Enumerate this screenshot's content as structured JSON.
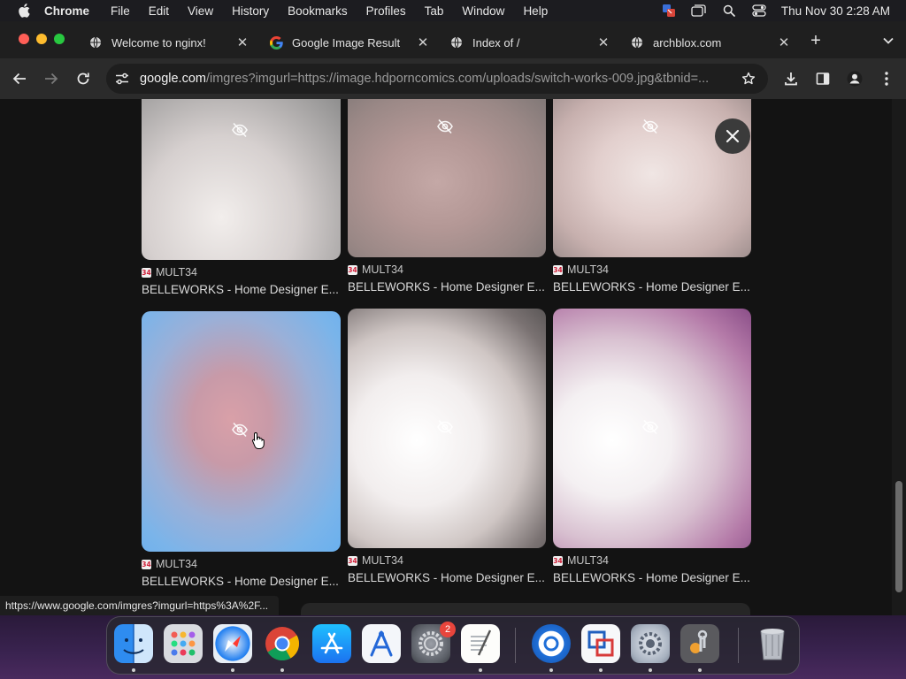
{
  "menubar": {
    "app_name": "Chrome",
    "menus": [
      "File",
      "Edit",
      "View",
      "History",
      "Bookmarks",
      "Profiles",
      "Tab",
      "Window",
      "Help"
    ],
    "clock": "Thu Nov 30  2:28 AM",
    "status_icons": [
      "screen-share-icon",
      "window-icon",
      "spotlight-search-icon",
      "control-center-icon"
    ]
  },
  "tabs": [
    {
      "label": "Welcome to nginx!",
      "favicon": "globe-icon"
    },
    {
      "label": "Google Image Result",
      "favicon": "google-icon"
    },
    {
      "label": "Index of /",
      "favicon": "globe-icon"
    },
    {
      "label": "archblox.com",
      "favicon": "globe-icon"
    }
  ],
  "newtab_label": "+",
  "toolbar": {
    "url_host": "google.com",
    "url_rest": "/imgres?imgurl=https://image.hdporncomics.com/uploads/switch-works-009.jpg&tbnid=..."
  },
  "results": [
    {
      "source": "MULT34",
      "badge": "34",
      "title": "BELLEWORKS - Home Designer E..."
    },
    {
      "source": "MULT34",
      "badge": "34",
      "title": "BELLEWORKS - Home Designer E..."
    },
    {
      "source": "MULT34",
      "badge": "34",
      "title": "BELLEWORKS - Home Designer E..."
    },
    {
      "source": "MULT34",
      "badge": "34",
      "title": "BELLEWORKS - Home Designer E..."
    },
    {
      "source": "MULT34",
      "badge": "34",
      "title": "BELLEWORKS - Home Designer E..."
    },
    {
      "source": "MULT34",
      "badge": "34",
      "title": "BELLEWORKS - Home Designer E..."
    }
  ],
  "status_bubble": "https://www.google.com/imgres?imgurl=https%3A%2F...",
  "dock": {
    "apps": [
      "finder-icon",
      "launchpad-icon",
      "safari-icon",
      "chrome-icon",
      "app-store-icon",
      "xcode-instruments-icon",
      "system-settings-icon",
      "textedit-icon",
      "sourcetree-icon",
      "vmware-icon",
      "system-preferences-icon",
      "keychain-access-icon",
      "trash-icon"
    ],
    "settings_badge": "2"
  },
  "colors": {
    "page_bg": "#131313",
    "toolbar_bg": "#2b2b2b",
    "tabstrip_bg": "#1f1f1f",
    "close_red": "#ff5f57",
    "minimize_yellow": "#febc2e",
    "zoom_green": "#28c840"
  }
}
